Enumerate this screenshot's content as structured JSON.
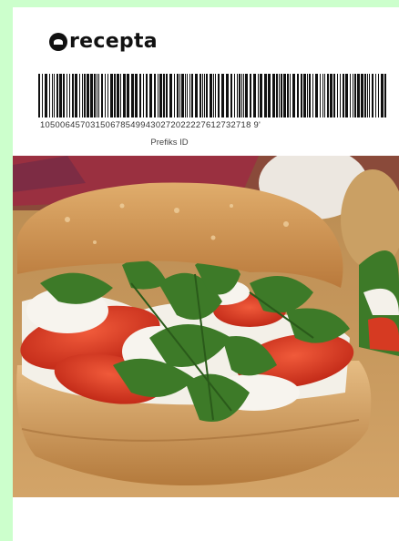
{
  "brand": {
    "name": "recepta"
  },
  "barcode": {
    "digits": "105006457031506785499430272022227612732718 9'",
    "caption": "Prefiks ID"
  },
  "photo": {
    "subject": "sandwich-photo"
  },
  "colors": {
    "page_background": "#ccffcc",
    "panel_background": "#ffffff",
    "tomato": "#d63a22",
    "arugula": "#3d7a28",
    "bread": "#c98a45",
    "board": "#c69a5c"
  }
}
